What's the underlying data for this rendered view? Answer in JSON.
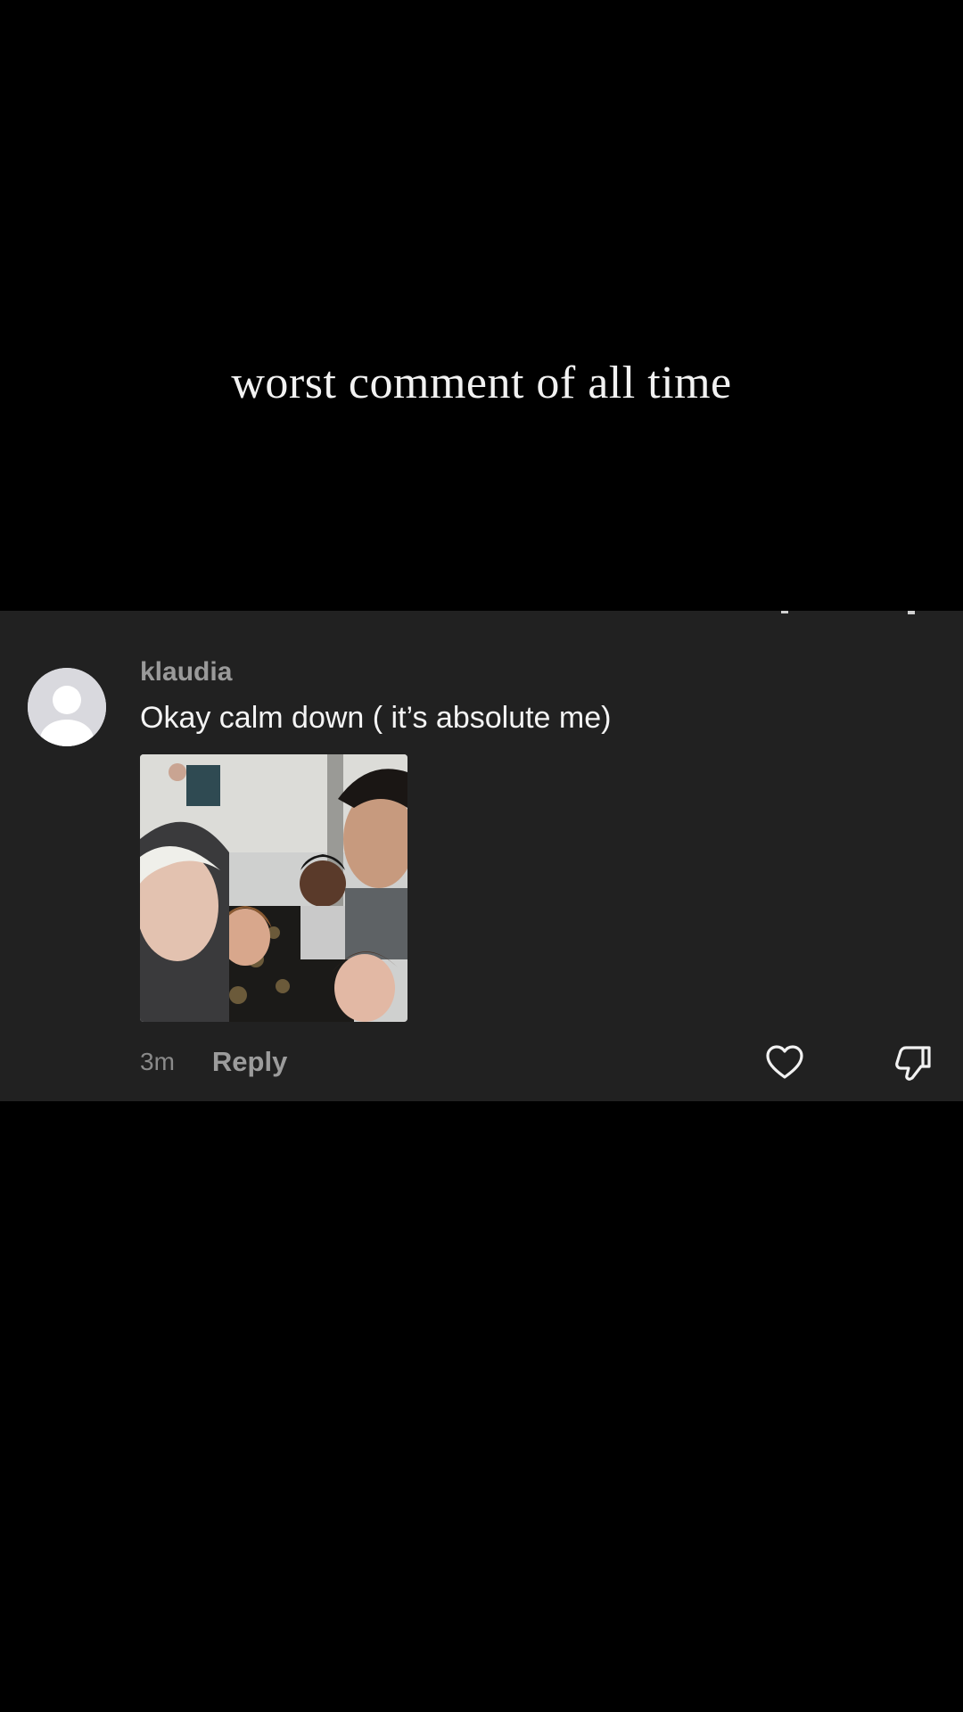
{
  "caption": "worst comment of all time",
  "comment": {
    "username": "klaudia",
    "text": "Okay calm down ( it’s absolute me)",
    "timestamp": "3m",
    "reply_label": "Reply",
    "avatar_icon": "default-avatar-icon",
    "like_icon": "heart-icon",
    "dislike_icon": "thumbs-down-icon"
  },
  "colors": {
    "background": "#000000",
    "card": "#212121",
    "username": "#9a9a9a",
    "text": "#f4f4f4",
    "meta": "#8a8a8a"
  }
}
